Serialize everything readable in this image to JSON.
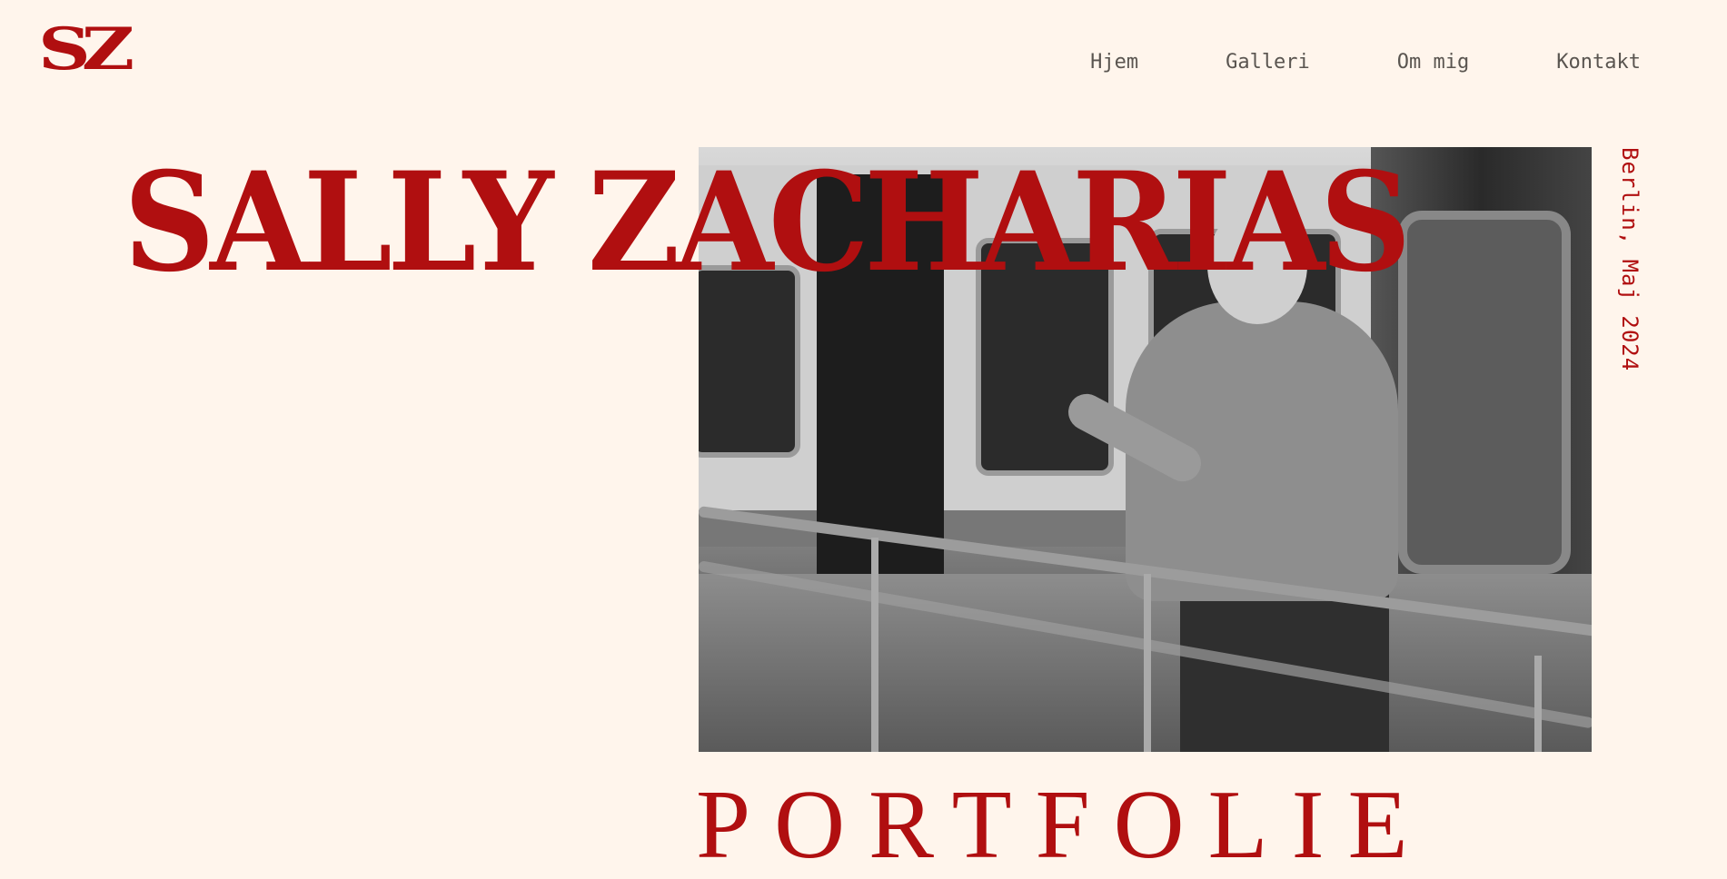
{
  "header": {
    "logo": "SZ",
    "nav": [
      {
        "label": "Hjem"
      },
      {
        "label": "Galleri"
      },
      {
        "label": "Om mig"
      },
      {
        "label": "Kontakt"
      }
    ]
  },
  "hero": {
    "name": "SALLY ZACHARIAS",
    "location_date": "Berlin, Maj 2024",
    "photo_icon": "photo-man-at-train-platform"
  },
  "section": {
    "heading": "PORTFOLIE"
  },
  "colors": {
    "background": "#FFF5EC",
    "accent": "#B00F10",
    "nav_text": "#5A5550"
  }
}
